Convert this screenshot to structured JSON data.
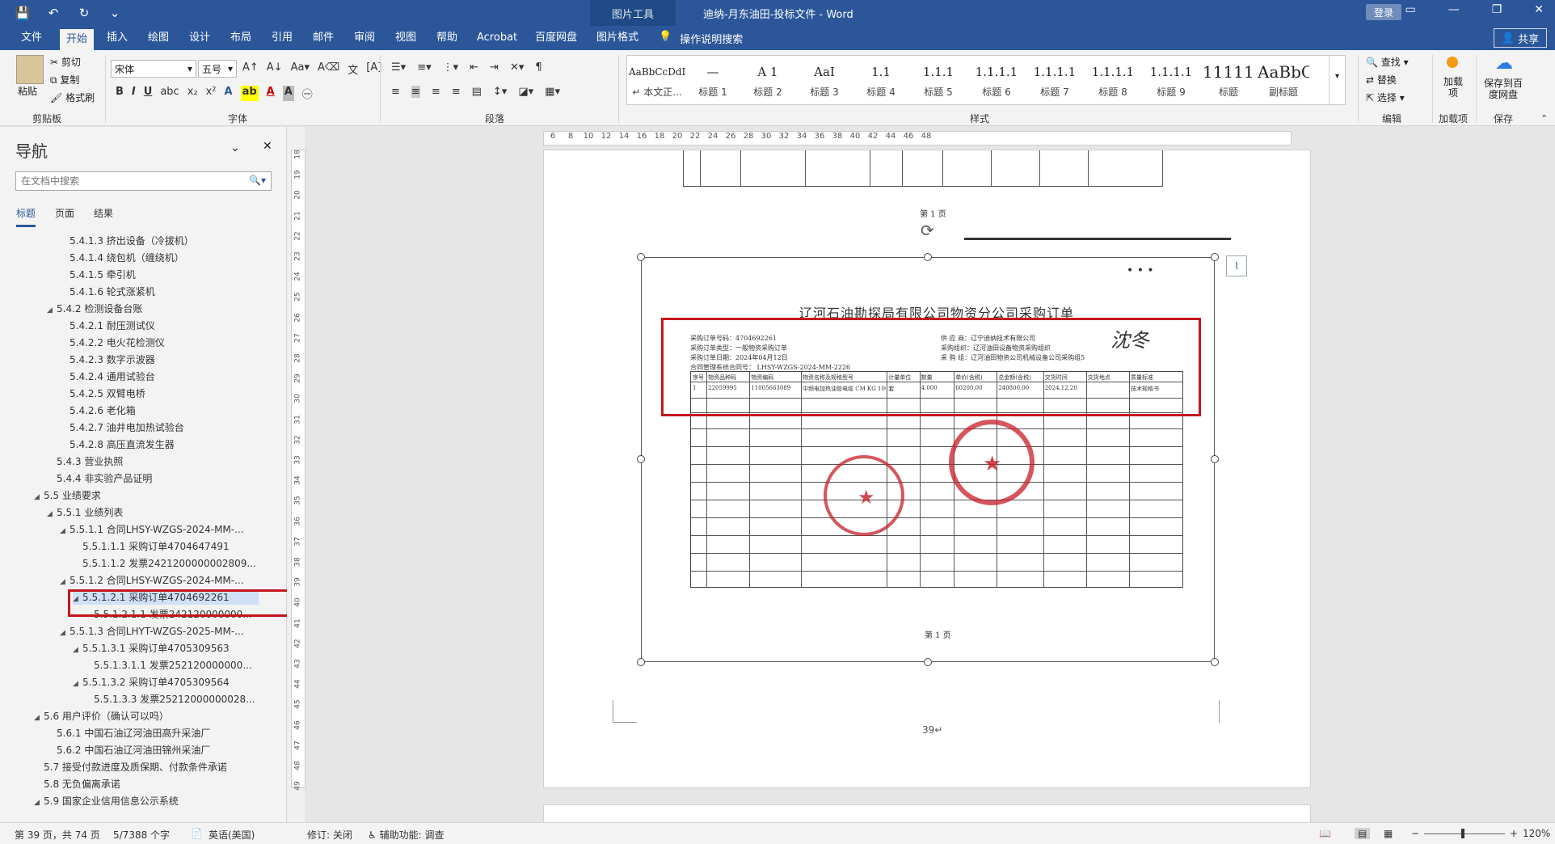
{
  "titlebar": {
    "context_tool": "图片工具",
    "title": "迪纳-月东油田-投标文件 - Word",
    "login": "登录"
  },
  "tabs": [
    {
      "label": "文件"
    },
    {
      "label": "开始"
    },
    {
      "label": "插入"
    },
    {
      "label": "绘图"
    },
    {
      "label": "设计"
    },
    {
      "label": "布局"
    },
    {
      "label": "引用"
    },
    {
      "label": "邮件"
    },
    {
      "label": "审阅"
    },
    {
      "label": "视图"
    },
    {
      "label": "帮助"
    },
    {
      "label": "Acrobat"
    },
    {
      "label": "百度网盘"
    },
    {
      "label": "图片格式"
    }
  ],
  "tell_me": "操作说明搜索",
  "share": "共享",
  "ribbon": {
    "clipboard": {
      "paste": "粘贴",
      "cut": "剪切",
      "copy": "复制",
      "format_painter": "格式刷",
      "label": "剪贴板"
    },
    "font": {
      "name": "宋体",
      "size": "五号",
      "label": "字体"
    },
    "paragraph": {
      "label": "段落"
    },
    "styles": {
      "label": "样式",
      "items": [
        {
          "sample": "AaBbCcDdI",
          "name": "↵ 本文正..."
        },
        {
          "sample": "—",
          "name": "标题 1"
        },
        {
          "sample": "A 1",
          "name": "标题 2"
        },
        {
          "sample": "AaI",
          "name": "标题 3"
        },
        {
          "sample": "1.1",
          "name": "标题 4"
        },
        {
          "sample": "1.1.1",
          "name": "标题 5"
        },
        {
          "sample": "1.1.1.1",
          "name": "标题 6"
        },
        {
          "sample": "1.1.1.1",
          "name": "标题 7"
        },
        {
          "sample": "1.1.1.1",
          "name": "标题 8"
        },
        {
          "sample": "1.1.1.1",
          "name": "标题 9"
        },
        {
          "sample": "1111111",
          "name": "标题"
        },
        {
          "sample": "AaBbC",
          "name": "副标题"
        },
        {
          "sample": "AaBbC",
          "name": ""
        }
      ]
    },
    "editing": {
      "find": "查找",
      "replace": "替换",
      "select": "选择",
      "label": "编辑"
    },
    "addins": {
      "btn": "加载项",
      "label": "加载项"
    },
    "save": {
      "btn": "保存到百度网盘",
      "label": "保存"
    }
  },
  "nav": {
    "title": "导航",
    "search_placeholder": "在文档中搜索",
    "tabs": [
      "标题",
      "页面",
      "结果"
    ],
    "tree": [
      {
        "text": "5.4.1.3 挤出设备（冷拔机）",
        "level": 3,
        "tri": ""
      },
      {
        "text": "5.4.1.4 绕包机（缠绕机）",
        "level": 3,
        "tri": ""
      },
      {
        "text": "5.4.1.5 牵引机",
        "level": 3,
        "tri": ""
      },
      {
        "text": "5.4.1.6 轮式涨紧机",
        "level": 3,
        "tri": ""
      },
      {
        "text": "5.4.2 检测设备台账",
        "level": 2,
        "tri": "◢"
      },
      {
        "text": "5.4.2.1 耐压测试仪",
        "level": 3,
        "tri": ""
      },
      {
        "text": "5.4.2.2 电火花检测仪",
        "level": 3,
        "tri": ""
      },
      {
        "text": "5.4.2.3 数字示波器",
        "level": 3,
        "tri": ""
      },
      {
        "text": "5.4.2.4 通用试验台",
        "level": 3,
        "tri": ""
      },
      {
        "text": "5.4.2.5 双臂电桥",
        "level": 3,
        "tri": ""
      },
      {
        "text": "5.4.2.6 老化箱",
        "level": 3,
        "tri": ""
      },
      {
        "text": "5.4.2.7 油井电加热试验台",
        "level": 3,
        "tri": ""
      },
      {
        "text": "5.4.2.8 高压直流发生器",
        "level": 3,
        "tri": ""
      },
      {
        "text": "5.4.3 营业执照",
        "level": 2,
        "tri": ""
      },
      {
        "text": "5.4.4 非实验产品证明",
        "level": 2,
        "tri": ""
      },
      {
        "text": "5.5 业绩要求",
        "level": 1,
        "tri": "◢"
      },
      {
        "text": "5.5.1 业绩列表",
        "level": 2,
        "tri": "◢"
      },
      {
        "text": "5.5.1.1 合同LHSY-WZGS-2024-MM-...",
        "level": 3,
        "tri": "◢"
      },
      {
        "text": "5.5.1.1.1 采购订单4704647491",
        "level": 4,
        "tri": ""
      },
      {
        "text": "5.5.1.1.2 发票2421200000002809...",
        "level": 4,
        "tri": ""
      },
      {
        "text": "5.5.1.2 合同LHSY-WZGS-2024-MM-...",
        "level": 3,
        "tri": "◢"
      },
      {
        "text": "5.5.1.2.1 采购订单4704692261",
        "level": 4,
        "tri": "◢",
        "selected": true
      },
      {
        "text": "5.5.1.2.1.1 发票242120000000...",
        "level": 5,
        "tri": ""
      },
      {
        "text": "5.5.1.3 合同LHYT-WZGS-2025-MM-...",
        "level": 3,
        "tri": "◢"
      },
      {
        "text": "5.5.1.3.1 采购订单4705309563",
        "level": 4,
        "tri": "◢"
      },
      {
        "text": "5.5.1.3.1.1 发票252120000000...",
        "level": 5,
        "tri": ""
      },
      {
        "text": "5.5.1.3.2 采购订单4705309564",
        "level": 4,
        "tri": "◢"
      },
      {
        "text": "5.5.1.3.3 发票25212000000028...",
        "level": 5,
        "tri": ""
      },
      {
        "text": "5.6 用户评价（确认可以吗）",
        "level": 1,
        "tri": "◢"
      },
      {
        "text": "5.6.1 中国石油辽河油田高升采油厂",
        "level": 2,
        "tri": ""
      },
      {
        "text": "5.6.2 中国石油辽河油田锦州采油厂",
        "level": 2,
        "tri": ""
      },
      {
        "text": "5.7 接受付款进度及质保期、付款条件承诺",
        "level": 1,
        "tri": ""
      },
      {
        "text": "5.8 无负偏离承诺",
        "level": 1,
        "tri": ""
      },
      {
        "text": "5.9 国家企业信用信息公示系统",
        "level": 1,
        "tri": "◢"
      }
    ]
  },
  "document": {
    "prev_page_footer": "第 1 页",
    "scan_title": "辽河石油勘探局有限公司物资分公司采购订单",
    "order_fields_left": [
      "采购订单号码：4704692261",
      "采购订单类型：一般物资采购订单",
      "采购订单日期：2024年04月12日",
      "合同管理系统合同号：   LHSY-WZGS-2024-MM-2226"
    ],
    "order_fields_right": [
      "供 应 商：辽宁迪纳技术有限公司",
      "采购组织：辽河油田设备物资采购组织",
      "采 购 组：辽河油田物资公司机械设备公司采购组5"
    ],
    "table_headers": [
      "序号",
      "物资品种码",
      "物资编码",
      "物资名称及规格型号",
      "计量单位",
      "数量",
      "单价(含税)",
      "总金额(含税)",
      "交货时间",
      "交货地点",
      "质量标准"
    ],
    "table_row": [
      "1",
      "22059995",
      "11005663089",
      "中频电加热油管电缆 CM KG 100",
      "套",
      "4.000",
      "60200.00",
      "240800.00",
      "2024.12.20",
      "",
      "技术规格书"
    ],
    "scan_footer": "第 1 页",
    "page_number": "39↵"
  },
  "status": {
    "page": "第 39 页，共 74 页",
    "words": "5/7388 个字",
    "lang": "英语(美国)",
    "track": "修订: 关闭",
    "access": "辅助功能: 调查",
    "zoom": "120%"
  }
}
